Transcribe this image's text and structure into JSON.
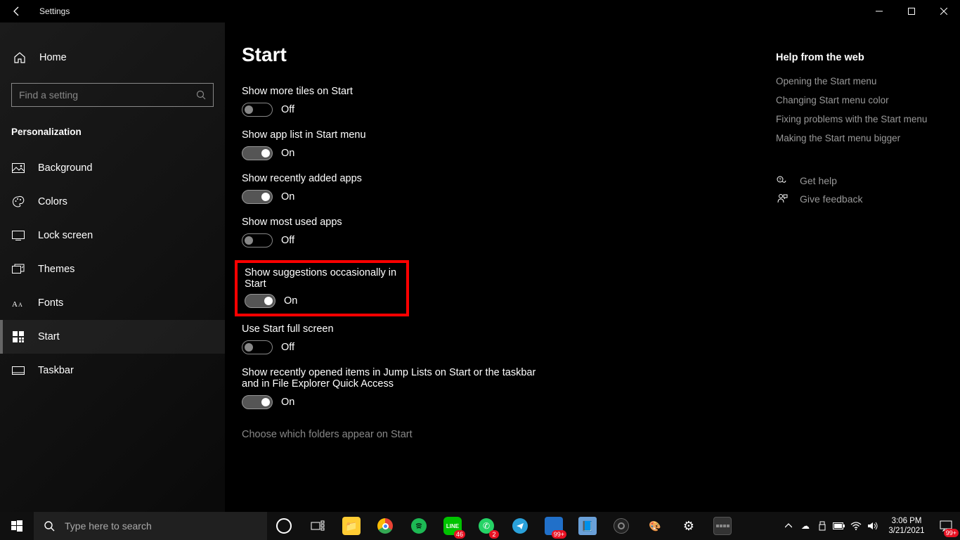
{
  "window": {
    "title": "Settings"
  },
  "sidebar": {
    "home": "Home",
    "search_placeholder": "Find a setting",
    "category": "Personalization",
    "items": [
      {
        "label": "Background"
      },
      {
        "label": "Colors"
      },
      {
        "label": "Lock screen"
      },
      {
        "label": "Themes"
      },
      {
        "label": "Fonts"
      },
      {
        "label": "Start"
      },
      {
        "label": "Taskbar"
      }
    ]
  },
  "page": {
    "heading": "Start",
    "settings": [
      {
        "label": "Show more tiles on Start",
        "on": false,
        "value": "Off"
      },
      {
        "label": "Show app list in Start menu",
        "on": true,
        "value": "On"
      },
      {
        "label": "Show recently added apps",
        "on": true,
        "value": "On"
      },
      {
        "label": "Show most used apps",
        "on": false,
        "value": "Off"
      },
      {
        "label": "Show suggestions occasionally in Start",
        "on": true,
        "value": "On",
        "highlighted": true
      },
      {
        "label": "Use Start full screen",
        "on": false,
        "value": "Off"
      },
      {
        "label": "Show recently opened items in Jump Lists on Start or the taskbar and in File Explorer Quick Access",
        "on": true,
        "value": "On"
      }
    ],
    "folders_link": "Choose which folders appear on Start"
  },
  "aside": {
    "heading": "Help from the web",
    "links": [
      "Opening the Start menu",
      "Changing Start menu color",
      "Fixing problems with the Start menu",
      "Making the Start menu bigger"
    ],
    "get_help": "Get help",
    "feedback": "Give feedback"
  },
  "taskbar": {
    "search_placeholder": "Type here to search",
    "badges": {
      "line": "46",
      "whatsapp": "2",
      "app": "99+",
      "notifications": "99+"
    },
    "time": "3:06 PM",
    "date": "3/21/2021"
  }
}
